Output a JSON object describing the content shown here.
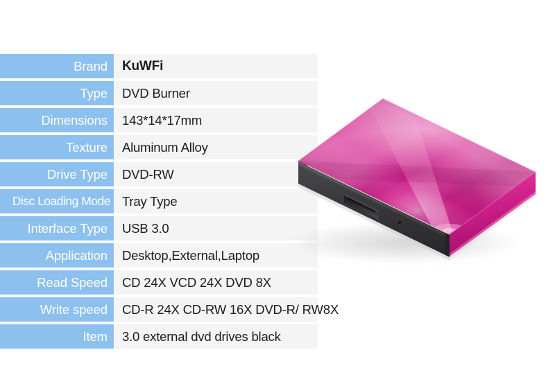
{
  "spec_table": {
    "rows": [
      {
        "label": "Brand",
        "value": "KuWFi",
        "bold": true
      },
      {
        "label": "Type",
        "value": "DVD Burner",
        "bold": false
      },
      {
        "label": "Dimensions",
        "value": "143*14*17mm",
        "bold": false
      },
      {
        "label": "Texture",
        "value": "Aluminum Alloy",
        "bold": false
      },
      {
        "label": "Drive Type",
        "value": "DVD-RW",
        "bold": false
      },
      {
        "label": "Disc Loading Mode",
        "value": "Tray Type",
        "bold": false
      },
      {
        "label": "Interface Type",
        "value": "USB 3.0",
        "bold": false
      },
      {
        "label": "Application",
        "value": "Desktop,External,Laptop",
        "bold": false
      },
      {
        "label": "Read Speed",
        "value": "CD 24X VCD 24X DVD 8X",
        "bold": false
      },
      {
        "label": "Write speed",
        "value": "CD-R 24X CD-RW 16X DVD-R/ RW8X",
        "bold": false
      },
      {
        "label": "Item",
        "value": "3.0 external dvd drives black",
        "bold": false
      }
    ]
  },
  "product_photo": {
    "alt": "pink external slim DVD drive",
    "colors": {
      "top_highlight": "#f06ec0",
      "top_mid": "#d6238f",
      "top_dark": "#9e0f63",
      "side": "#d41f8c",
      "bezel": "#3a3a3c",
      "shadow": "#b9b9bd"
    }
  },
  "theme": {
    "label_blue": "#8cc0ee",
    "value_gray": "#f4f4f4",
    "text_dark": "#1c1c1c",
    "label_text": "#ffffff",
    "background": "#ffffff"
  }
}
